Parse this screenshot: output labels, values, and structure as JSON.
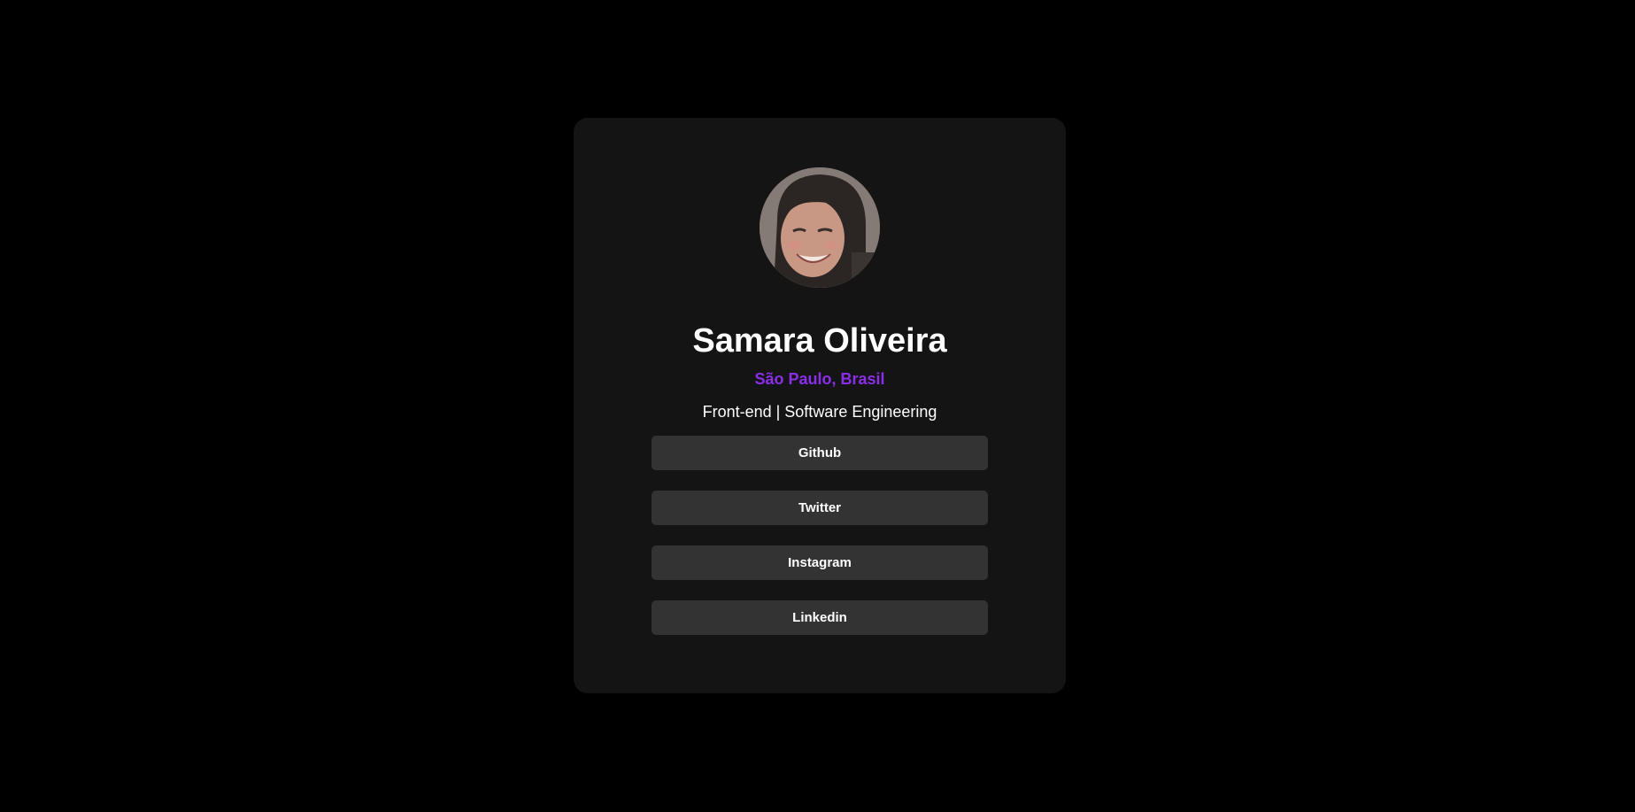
{
  "profile": {
    "avatar_alt": "avatar",
    "name": "Samara Oliveira",
    "location": "São Paulo, Brasil",
    "bio": "Front-end | Software Engineering"
  },
  "links": [
    {
      "label": "Github"
    },
    {
      "label": "Twitter"
    },
    {
      "label": "Instagram"
    },
    {
      "label": "Linkedin"
    }
  ],
  "colors": {
    "background": "#000000",
    "card": "#141414",
    "button": "#333333",
    "accent": "#8b2ee8",
    "text": "#ffffff"
  }
}
